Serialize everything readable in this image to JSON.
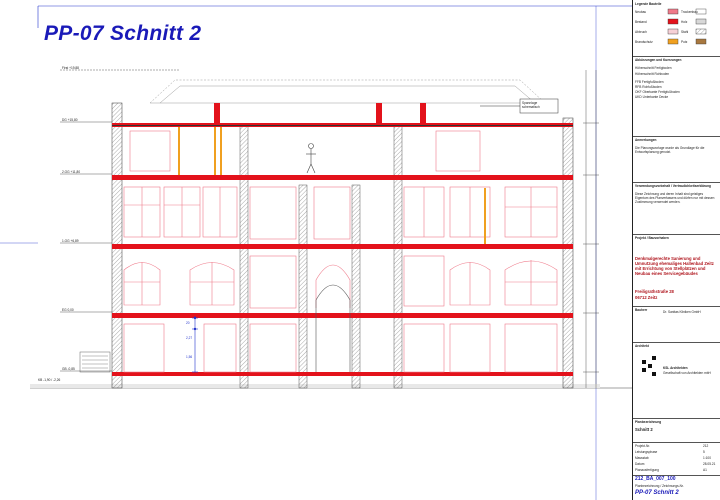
{
  "sheet_title": "PP-07 Schnitt 2",
  "annotation_spannanlage": "Spannlage\nschematisch",
  "levels": {
    "first": "First +19,88",
    "l5": "DG +15,80",
    "l4": "2.OG +11,80",
    "l3": "1.OG +6,89",
    "l2": "EG 0,00",
    "l1": "GB -0,85",
    "l0": "KB -1,90 / -2,26"
  },
  "dimensions": {
    "d1": "20",
    "d2": "2,27",
    "d3": "1,56"
  },
  "titleblock": {
    "legend_heading": "Legende Bauteile",
    "legend_items": [
      "Neubau",
      "Bestand",
      "Abbruch",
      "Brandschutz",
      "Trockenbau",
      "Holz",
      "Stahl",
      "Putz"
    ],
    "abbrev_heading": "Abkürzungen und Kuerzungen",
    "abbrev_lines": [
      "Höhenschnitt Fertigboden",
      "Höhenschnitt Rohboden",
      "FFB Fertigfußboden",
      "RFB Rohfußboden",
      "OKF Oberkante Fertigfußboden",
      "UKD Unterkante Decke"
    ],
    "notes_heading": "Anmerkungen",
    "notes_text": "Die Planungsvorlage wurde als Grundlage für die Entwurfsplanung genutzt.",
    "notes2_heading": "Verwendungsvorbehalt / Vertraulichkeitserklärung",
    "notes2_text": "Diese Zeichnung und deren Inhalt sind geistiges Eigentum des Planverfassers und dürfen nur mit dessen Zustimmung verwendet werden.",
    "project_heading": "Projekt / Bauvorhaben",
    "project_text": "Denkmalgerechte Sanierung und Umnutzung ehemaliges Hallenbad Zeitz mit Errichtung von Stellplätzen und Neubau eines Servicegebäudes",
    "address_line1": "Freiligrathstraße 28",
    "address_line2": "06712 Zeitz",
    "client_heading": "Bauherr",
    "client_text": "Dr. Sanitas Kliniken GmbH",
    "architect_heading": "Architekt",
    "architect_name": "KSL Architekten",
    "architect_text": "Gesellschaft von Architekten mbH",
    "planinfo_heading": "Planbezeichnung",
    "planinfo_value": "Schnitt 2",
    "rows": [
      {
        "label": "Projekt-Nr.",
        "value": "212"
      },
      {
        "label": "Leistungsphase",
        "value": "5"
      },
      {
        "label": "Massstab",
        "value": "1:100"
      },
      {
        "label": "Datum",
        "value": "28.05.21"
      },
      {
        "label": "Planausfertigung",
        "value": "A1"
      }
    ],
    "plan_number": "212_BA_007_100",
    "plan_number_label": "Planbezeichnung / Zeichnungs-Nr.",
    "footer_title": "PP-07 Schnitt 2"
  },
  "colors": {
    "title_blue": "#1a1ab8",
    "slab_red": "#e3121b",
    "pink": "#ef7a8a",
    "orange": "#f0a020",
    "blue_dim": "#2233cc"
  }
}
